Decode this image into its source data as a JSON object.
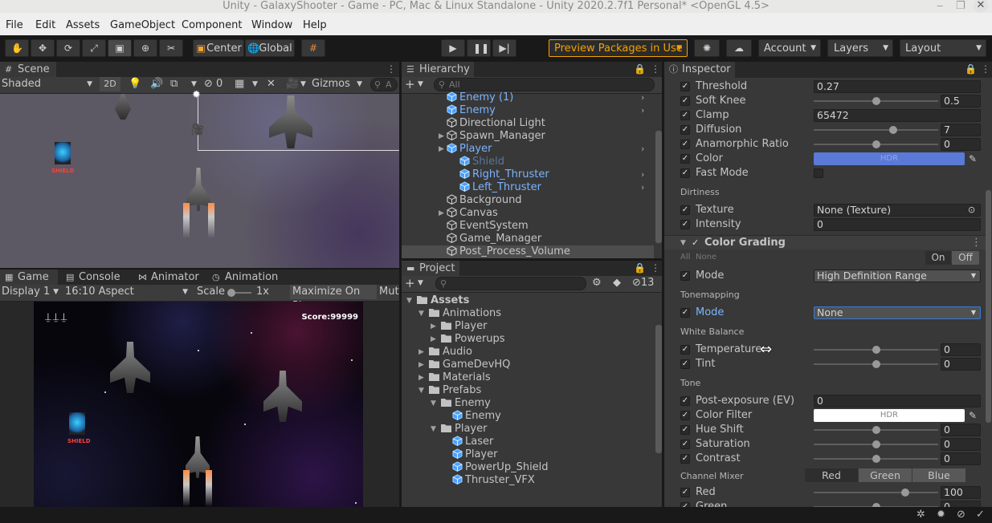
{
  "window": {
    "title": "Unity - GalaxyShooter - Game - PC, Mac & Linux Standalone - Unity 2020.2.7f1 Personal* <OpenGL 4.5>",
    "controls": [
      "minimize-icon",
      "restore-icon",
      "close-icon"
    ]
  },
  "menu": [
    "File",
    "Edit",
    "Assets",
    "GameObject",
    "Component",
    "Window",
    "Help"
  ],
  "toolbar": {
    "center": "Center",
    "global": "Global",
    "preview": "Preview Packages in Use",
    "account": "Account",
    "layers": "Layers",
    "layout": "Layout",
    "accent": "#f4a200"
  },
  "scene": {
    "tab": "Scene",
    "shading": "Shaded",
    "mode2d": "2D",
    "hidden_count": "0",
    "gizmos": "Gizmos",
    "search_glyph": "A",
    "shield_label": "SHIELD"
  },
  "game": {
    "tabs": [
      "Game",
      "Console",
      "Animator",
      "Animation"
    ],
    "display": "Display 1",
    "aspect": "16:10 Aspect",
    "scale_label": "Scale",
    "scale_value": "1x",
    "maximize": "Maximize On Play",
    "mute": "Mut",
    "score": "Score:99999",
    "shield_label": "SHIELD"
  },
  "hierarchy": {
    "tab": "Hierarchy",
    "search_placeholder": "All",
    "items": [
      {
        "label": "Enemy (1)",
        "style": "blue",
        "icon": "prefab-cube-icon",
        "arrow": true
      },
      {
        "label": "Enemy",
        "style": "blue",
        "icon": "prefab-cube-icon",
        "arrow": true
      },
      {
        "label": "Directional Light",
        "style": "normal",
        "icon": "gameobject-cube-icon"
      },
      {
        "label": "Spawn_Manager",
        "style": "normal",
        "icon": "gameobject-cube-icon",
        "fold": true
      },
      {
        "label": "Player",
        "style": "blue",
        "icon": "prefab-cube-icon",
        "fold": true,
        "arrow": true
      },
      {
        "label": "Shield",
        "style": "disabled",
        "icon": "prefab-cube-icon"
      },
      {
        "label": "Right_Thruster",
        "style": "blue",
        "icon": "prefab-added-icon",
        "arrow": true
      },
      {
        "label": "Left_Thruster",
        "style": "blue",
        "icon": "prefab-added-icon",
        "arrow": true
      },
      {
        "label": "Background",
        "style": "normal",
        "icon": "gameobject-cube-icon"
      },
      {
        "label": "Canvas",
        "style": "normal",
        "icon": "gameobject-cube-icon",
        "fold": true
      },
      {
        "label": "EventSystem",
        "style": "normal",
        "icon": "gameobject-cube-icon"
      },
      {
        "label": "Game_Manager",
        "style": "normal",
        "icon": "gameobject-cube-icon"
      },
      {
        "label": "Post_Process_Volume",
        "style": "selected",
        "icon": "gameobject-cube-icon"
      }
    ]
  },
  "project": {
    "tab": "Project",
    "hidden_count": "13",
    "tree": [
      {
        "label": "Assets",
        "depth": 0,
        "type": "folder",
        "open": true,
        "bold": true
      },
      {
        "label": "Animations",
        "depth": 1,
        "type": "folder",
        "open": true
      },
      {
        "label": "Player",
        "depth": 2,
        "type": "folder",
        "fold": true
      },
      {
        "label": "Powerups",
        "depth": 2,
        "type": "folder",
        "fold": true
      },
      {
        "label": "Audio",
        "depth": 1,
        "type": "folder",
        "fold": true
      },
      {
        "label": "GameDevHQ",
        "depth": 1,
        "type": "folder",
        "fold": true
      },
      {
        "label": "Materials",
        "depth": 1,
        "type": "folder",
        "fold": true
      },
      {
        "label": "Prefabs",
        "depth": 1,
        "type": "folder",
        "open": true
      },
      {
        "label": "Enemy",
        "depth": 2,
        "type": "folder",
        "open": true
      },
      {
        "label": "Enemy",
        "depth": 3,
        "type": "prefab"
      },
      {
        "label": "Player",
        "depth": 2,
        "type": "folder",
        "open": true
      },
      {
        "label": "Laser",
        "depth": 3,
        "type": "prefab"
      },
      {
        "label": "Player",
        "depth": 3,
        "type": "prefab"
      },
      {
        "label": "PowerUp_Shield",
        "depth": 3,
        "type": "prefab"
      },
      {
        "label": "Thruster_VFX",
        "depth": 3,
        "type": "prefab"
      }
    ]
  },
  "inspector": {
    "tab": "Inspector",
    "bloom": [
      {
        "label": "Threshold",
        "kind": "field",
        "value": "0.27"
      },
      {
        "label": "Soft Knee",
        "kind": "slider",
        "value": "0.5",
        "level": 0.5
      },
      {
        "label": "Clamp",
        "kind": "field",
        "value": "65472"
      },
      {
        "label": "Diffusion",
        "kind": "slider",
        "value": "7",
        "level": 0.65
      },
      {
        "label": "Anamorphic Ratio",
        "kind": "slider",
        "value": "0",
        "level": 0.5
      },
      {
        "label": "Color",
        "kind": "color",
        "value": "HDR",
        "color": "#5b79d6"
      },
      {
        "label": "Fast Mode",
        "kind": "toggle"
      }
    ],
    "dirtiness_header": "Dirtiness",
    "dirtiness": [
      {
        "label": "Texture",
        "kind": "object",
        "value": "None (Texture)"
      },
      {
        "label": "Intensity",
        "kind": "field",
        "value": "0"
      }
    ],
    "color_grading": "Color Grading",
    "all_label": "All",
    "none_label": "None",
    "on_label": "On",
    "off_label": "Off",
    "mode_label": "Mode",
    "mode_value": "High Definition Range",
    "tonemapping_header": "Tonemapping",
    "tonemapping_mode": "Mode",
    "tonemapping_value": "None",
    "white_balance_header": "White Balance",
    "white_balance": [
      {
        "label": "Temperature",
        "kind": "slider",
        "value": "0",
        "level": 0.5
      },
      {
        "label": "Tint",
        "kind": "slider",
        "value": "0",
        "level": 0.5
      }
    ],
    "tone_header": "Tone",
    "tone": [
      {
        "label": "Post-exposure (EV)",
        "kind": "field",
        "value": "0"
      },
      {
        "label": "Color Filter",
        "kind": "color",
        "value": "HDR",
        "color": "#ffffff"
      },
      {
        "label": "Hue Shift",
        "kind": "slider",
        "value": "0",
        "level": 0.5
      },
      {
        "label": "Saturation",
        "kind": "slider",
        "value": "0",
        "level": 0.5
      },
      {
        "label": "Contrast",
        "kind": "slider",
        "value": "0",
        "level": 0.5
      }
    ],
    "channel_mixer_header": "Channel Mixer",
    "channel_tabs": [
      "Red",
      "Green",
      "Blue"
    ],
    "channel": [
      {
        "label": "Red",
        "kind": "slider",
        "value": "100",
        "level": 0.75
      },
      {
        "label": "Green",
        "kind": "slider",
        "value": "0",
        "level": 0.5
      }
    ]
  }
}
